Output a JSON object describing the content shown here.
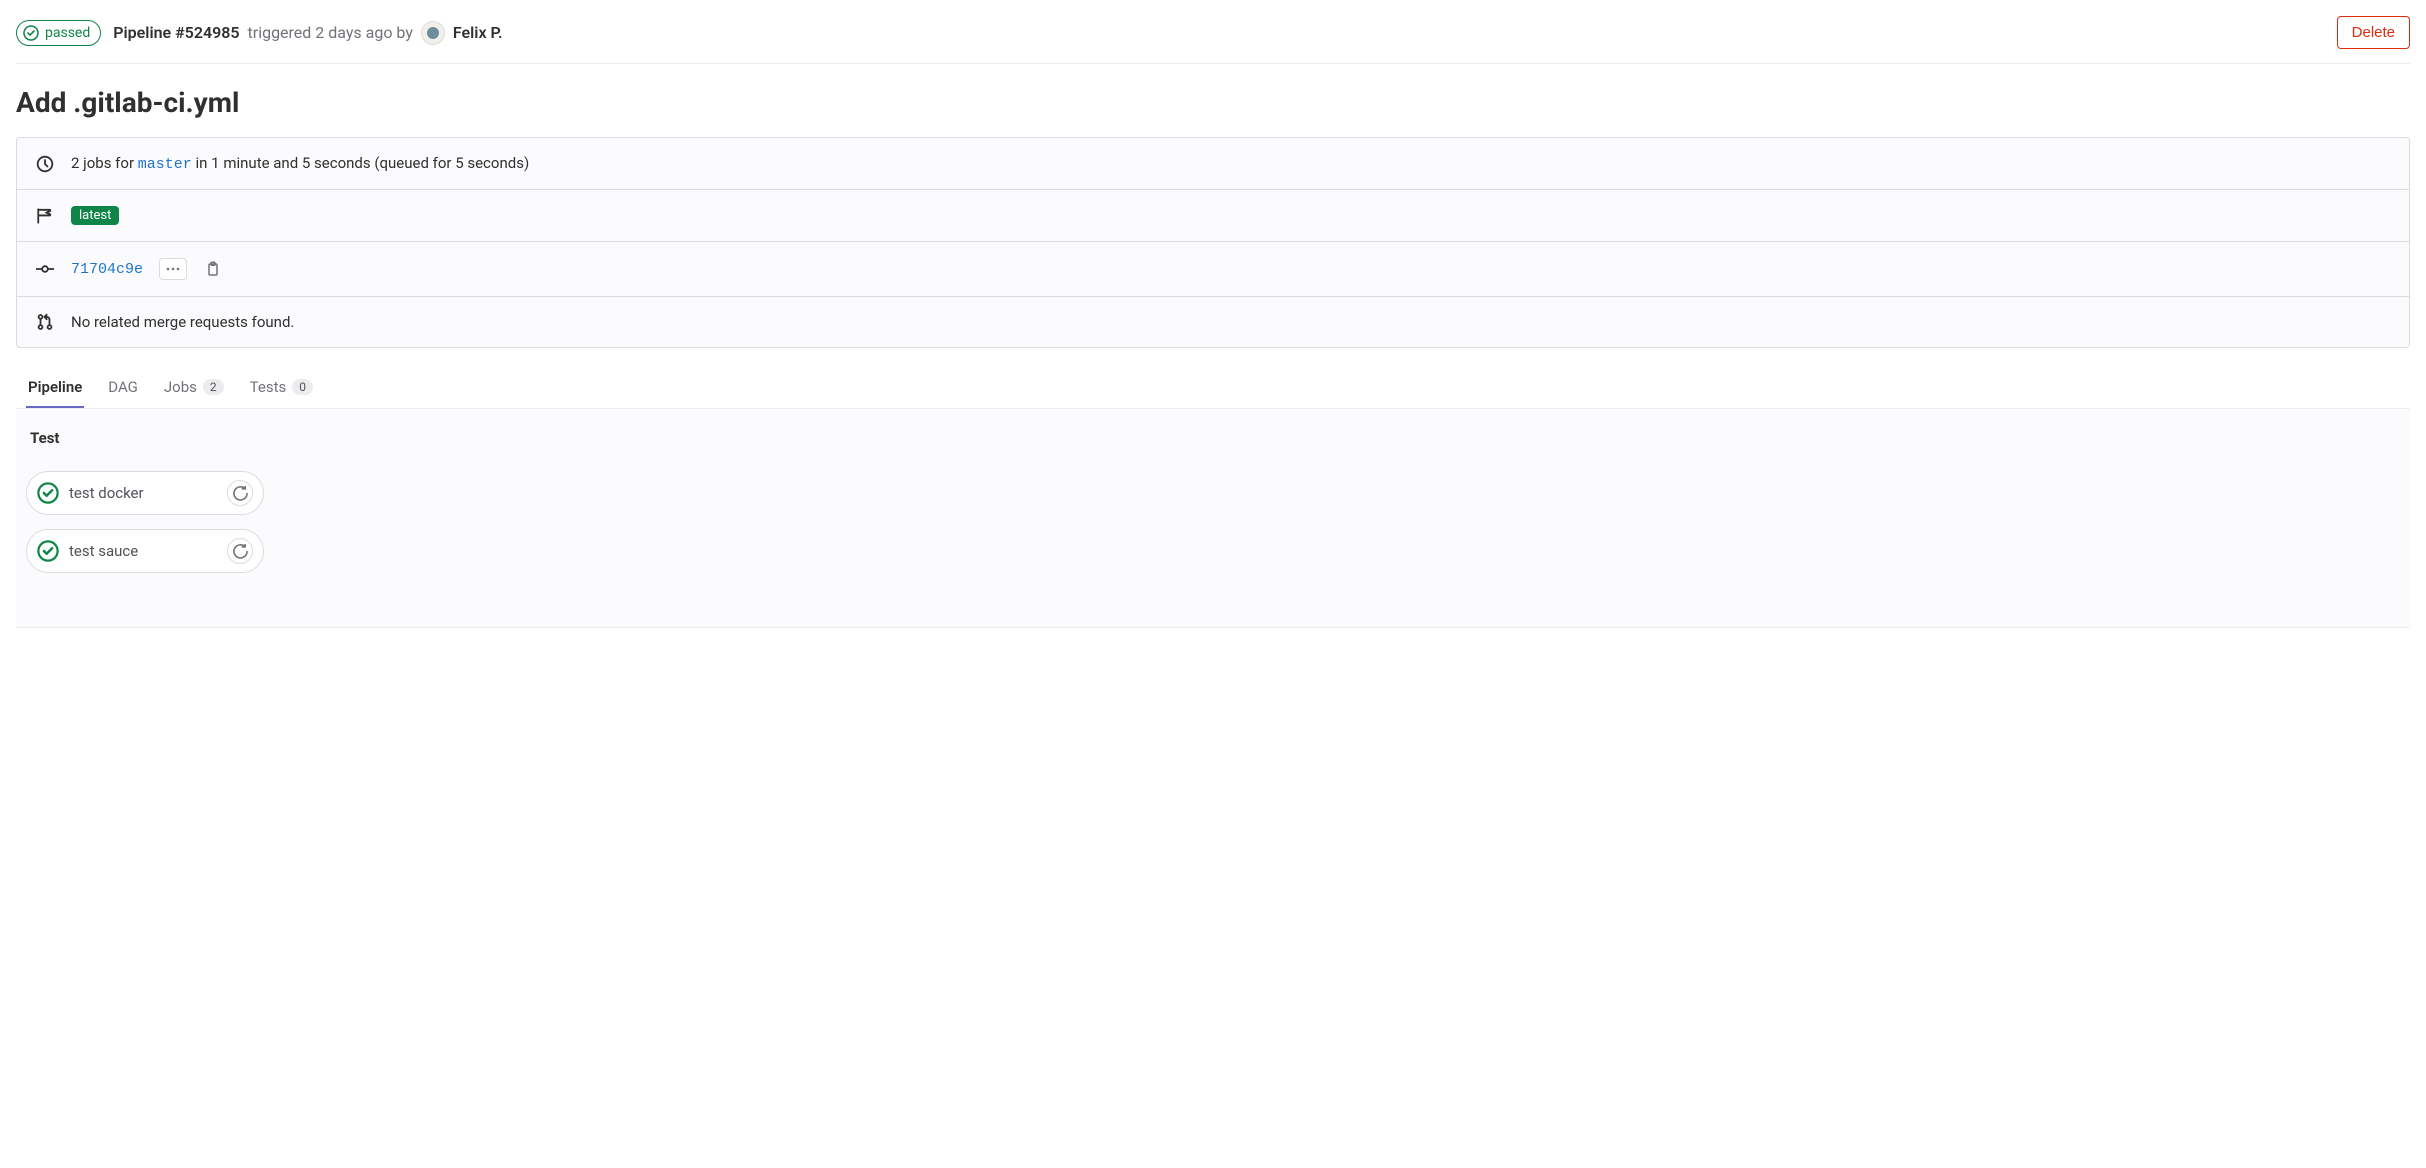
{
  "header": {
    "status": "passed",
    "pipeline_label": "Pipeline #524985",
    "trigger_text": "triggered 2 days ago by",
    "user_name": "Felix P.",
    "delete_label": "Delete"
  },
  "title": "Add .gitlab-ci.yml",
  "info": {
    "jobs_prefix": "2 jobs for",
    "branch": "master",
    "jobs_suffix": "in 1 minute and 5 seconds (queued for 5 seconds)",
    "latest_label": "latest",
    "commit_sha": "71704c9e",
    "mr_text": "No related merge requests found."
  },
  "tabs": {
    "pipeline": "Pipeline",
    "dag": "DAG",
    "jobs": "Jobs",
    "jobs_count": "2",
    "tests": "Tests",
    "tests_count": "0"
  },
  "stage": {
    "name": "Test",
    "jobs": [
      {
        "name": "test docker"
      },
      {
        "name": "test sauce"
      }
    ]
  }
}
